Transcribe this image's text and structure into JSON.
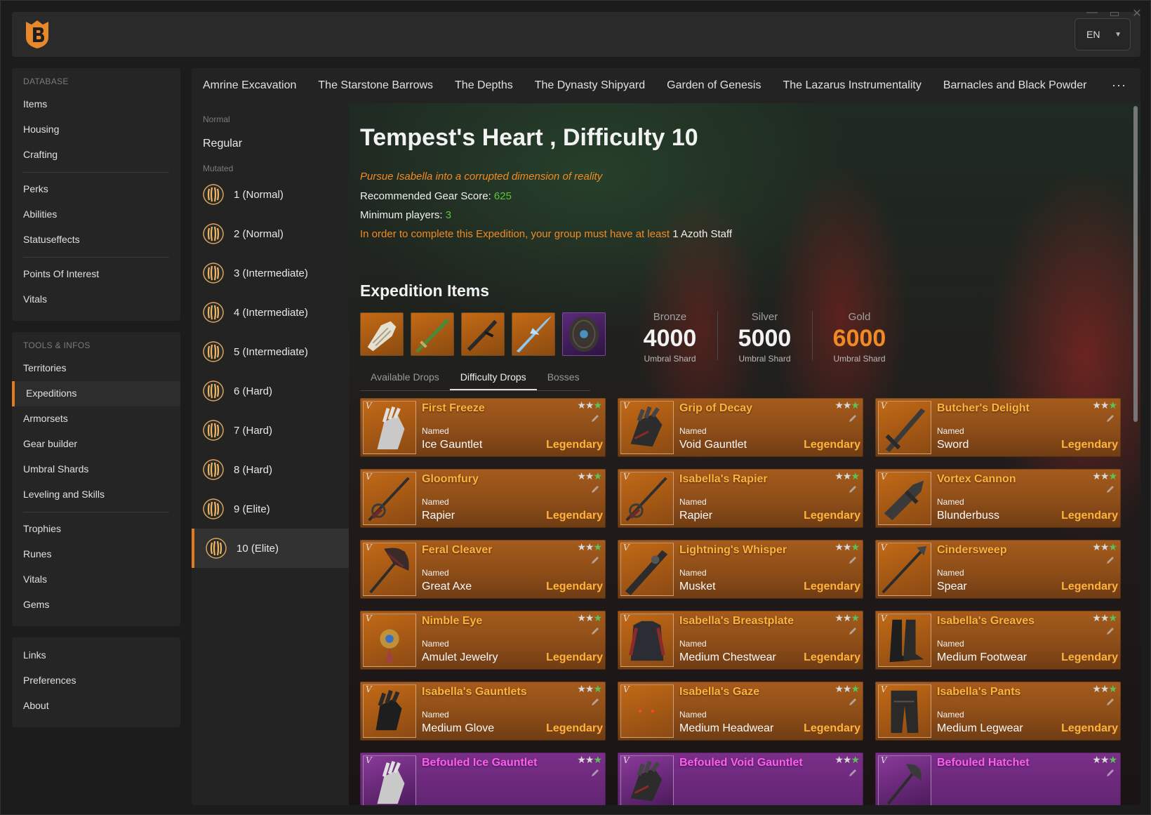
{
  "window": {
    "minimize": "—",
    "maximize": "▭",
    "close": "✕"
  },
  "header": {
    "language": "EN"
  },
  "sidebar": {
    "database_heading": "DATABASE",
    "database_items": [
      "Items",
      "Housing",
      "Crafting"
    ],
    "database_items2": [
      "Perks",
      "Abilities",
      "Statuseffects"
    ],
    "database_items3": [
      "Points Of Interest",
      "Vitals"
    ],
    "tools_heading": "TOOLS & INFOS",
    "tools_items": [
      "Territories",
      "Expeditions",
      "Armorsets",
      "Gear builder",
      "Umbral Shards",
      "Leveling and Skills"
    ],
    "tools_items2": [
      "Trophies",
      "Runes",
      "Vitals",
      "Gems"
    ],
    "links_items": [
      "Links",
      "Preferences",
      "About"
    ],
    "active_item": "Expeditions"
  },
  "expedition_tabs": [
    "Amrine Excavation",
    "The Starstone Barrows",
    "The Depths",
    "The Dynasty Shipyard",
    "Garden of Genesis",
    "The Lazarus Instrumentality",
    "Barnacles and Black Powder"
  ],
  "more_label": "···",
  "difficulty": {
    "normal_label": "Normal",
    "regular": "Regular",
    "mutated_label": "Mutated",
    "levels": [
      "1 (Normal)",
      "2 (Normal)",
      "3 (Intermediate)",
      "4 (Intermediate)",
      "5 (Intermediate)",
      "6 (Hard)",
      "7 (Hard)",
      "8 (Hard)",
      "9 (Elite)",
      "10 (Elite)"
    ],
    "active": "10 (Elite)"
  },
  "expedition": {
    "title": "Tempest's Heart , Difficulty 10",
    "description": "Pursue Isabella into a corrupted dimension of reality",
    "gear_score_label": "Recommended Gear Score: ",
    "gear_score": "625",
    "min_players_label": "Minimum players: ",
    "min_players": "3",
    "requirement": "In order to complete this Expedition, your group must have at least ",
    "requirement_item": "1 Azoth Staff"
  },
  "expedition_items_title": "Expedition Items",
  "shards": [
    {
      "tier": "Bronze",
      "amount": "4000",
      "unit": "Umbral Shard"
    },
    {
      "tier": "Silver",
      "amount": "5000",
      "unit": "Umbral Shard"
    },
    {
      "tier": "Gold",
      "amount": "6000",
      "unit": "Umbral Shard"
    }
  ],
  "drop_tabs": [
    "Available Drops",
    "Difficulty Drops",
    "Bosses"
  ],
  "active_drop_tab": "Difficulty Drops",
  "item_tier_mark": "V",
  "items": [
    {
      "name": "First Freeze",
      "named": "Named",
      "type": "Ice Gauntlet",
      "rarity": "Legendary",
      "icon": "gauntlet-icon"
    },
    {
      "name": "Grip of Decay",
      "named": "Named",
      "type": "Void Gauntlet",
      "rarity": "Legendary",
      "icon": "void-gauntlet-icon"
    },
    {
      "name": "Butcher's Delight",
      "named": "Named",
      "type": "Sword",
      "rarity": "Legendary",
      "icon": "sword-icon"
    },
    {
      "name": "Gloomfury",
      "named": "Named",
      "type": "Rapier",
      "rarity": "Legendary",
      "icon": "rapier-icon"
    },
    {
      "name": "Isabella's Rapier",
      "named": "Named",
      "type": "Rapier",
      "rarity": "Legendary",
      "icon": "rapier-icon"
    },
    {
      "name": "Vortex Cannon",
      "named": "Named",
      "type": "Blunderbuss",
      "rarity": "Legendary",
      "icon": "blunderbuss-icon"
    },
    {
      "name": "Feral Cleaver",
      "named": "Named",
      "type": "Great Axe",
      "rarity": "Legendary",
      "icon": "great-axe-icon"
    },
    {
      "name": "Lightning's Whisper",
      "named": "Named",
      "type": "Musket",
      "rarity": "Legendary",
      "icon": "musket-icon"
    },
    {
      "name": "Cindersweep",
      "named": "Named",
      "type": "Spear",
      "rarity": "Legendary",
      "icon": "spear-icon"
    },
    {
      "name": "Nimble Eye",
      "named": "Named",
      "type": "Amulet Jewelry",
      "rarity": "Legendary",
      "icon": "amulet-icon"
    },
    {
      "name": "Isabella's Breastplate",
      "named": "Named",
      "type": "Medium Chestwear",
      "rarity": "Legendary",
      "icon": "chestwear-icon"
    },
    {
      "name": "Isabella's Greaves",
      "named": "Named",
      "type": "Medium Footwear",
      "rarity": "Legendary",
      "icon": "boots-icon"
    },
    {
      "name": "Isabella's Gauntlets",
      "named": "Named",
      "type": "Medium Glove",
      "rarity": "Legendary",
      "icon": "glove-icon"
    },
    {
      "name": "Isabella's Gaze",
      "named": "Named",
      "type": "Medium Headwear",
      "rarity": "Legendary",
      "icon": "headwear-icon"
    },
    {
      "name": "Isabella's Pants",
      "named": "Named",
      "type": "Medium Legwear",
      "rarity": "Legendary",
      "icon": "pants-icon"
    },
    {
      "name": "Befouled Ice Gauntlet",
      "named": "",
      "type": "",
      "rarity": "",
      "icon": "gauntlet-icon",
      "style": "purple"
    },
    {
      "name": "Befouled Void Gauntlet",
      "named": "",
      "type": "",
      "rarity": "",
      "icon": "void-gauntlet-icon",
      "style": "purple"
    },
    {
      "name": "Befouled Hatchet",
      "named": "",
      "type": "",
      "rarity": "",
      "icon": "hatchet-icon",
      "style": "purple"
    }
  ],
  "colors": {
    "accent": "#e07b1f",
    "legendary": "#ffb33a",
    "artifact": "#ff5cf0",
    "green": "#5fc238"
  }
}
